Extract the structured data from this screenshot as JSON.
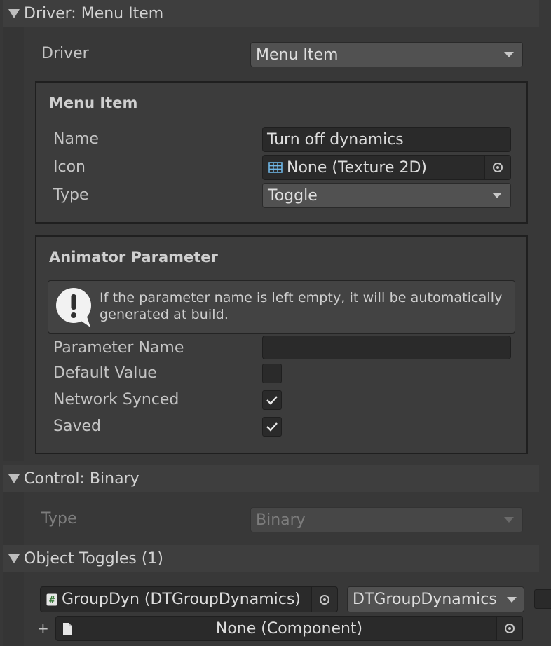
{
  "driver_section": {
    "header": "Driver: Menu Item",
    "driver_label": "Driver",
    "driver_value": "Menu Item"
  },
  "menu_item_box": {
    "title": "Menu Item",
    "name_label": "Name",
    "name_value": "Turn off dynamics",
    "icon_label": "Icon",
    "icon_value": "None (Texture 2D)",
    "type_label": "Type",
    "type_value": "Toggle"
  },
  "animator_box": {
    "title": "Animator Parameter",
    "help_text_line1": "If the parameter name is left empty, it will be automatically",
    "help_text_line2": "generated at build.",
    "param_name_label": "Parameter Name",
    "param_name_value": "",
    "default_value_label": "Default Value",
    "default_value_checked": false,
    "network_synced_label": "Network Synced",
    "network_synced_checked": true,
    "saved_label": "Saved",
    "saved_checked": true
  },
  "control_section": {
    "header": "Control: Binary",
    "type_label": "Type",
    "type_value": "Binary"
  },
  "object_toggles": {
    "header": "Object Toggles (1)",
    "item_object": "GroupDyn (DTGroupDynamics)",
    "item_component": "DTGroupDynamics",
    "add_label": "+",
    "new_object": "None (Component)"
  },
  "colors": {
    "background": "#383838",
    "field": "#2a2a2a",
    "icon_accent": "#6fb6e6"
  }
}
